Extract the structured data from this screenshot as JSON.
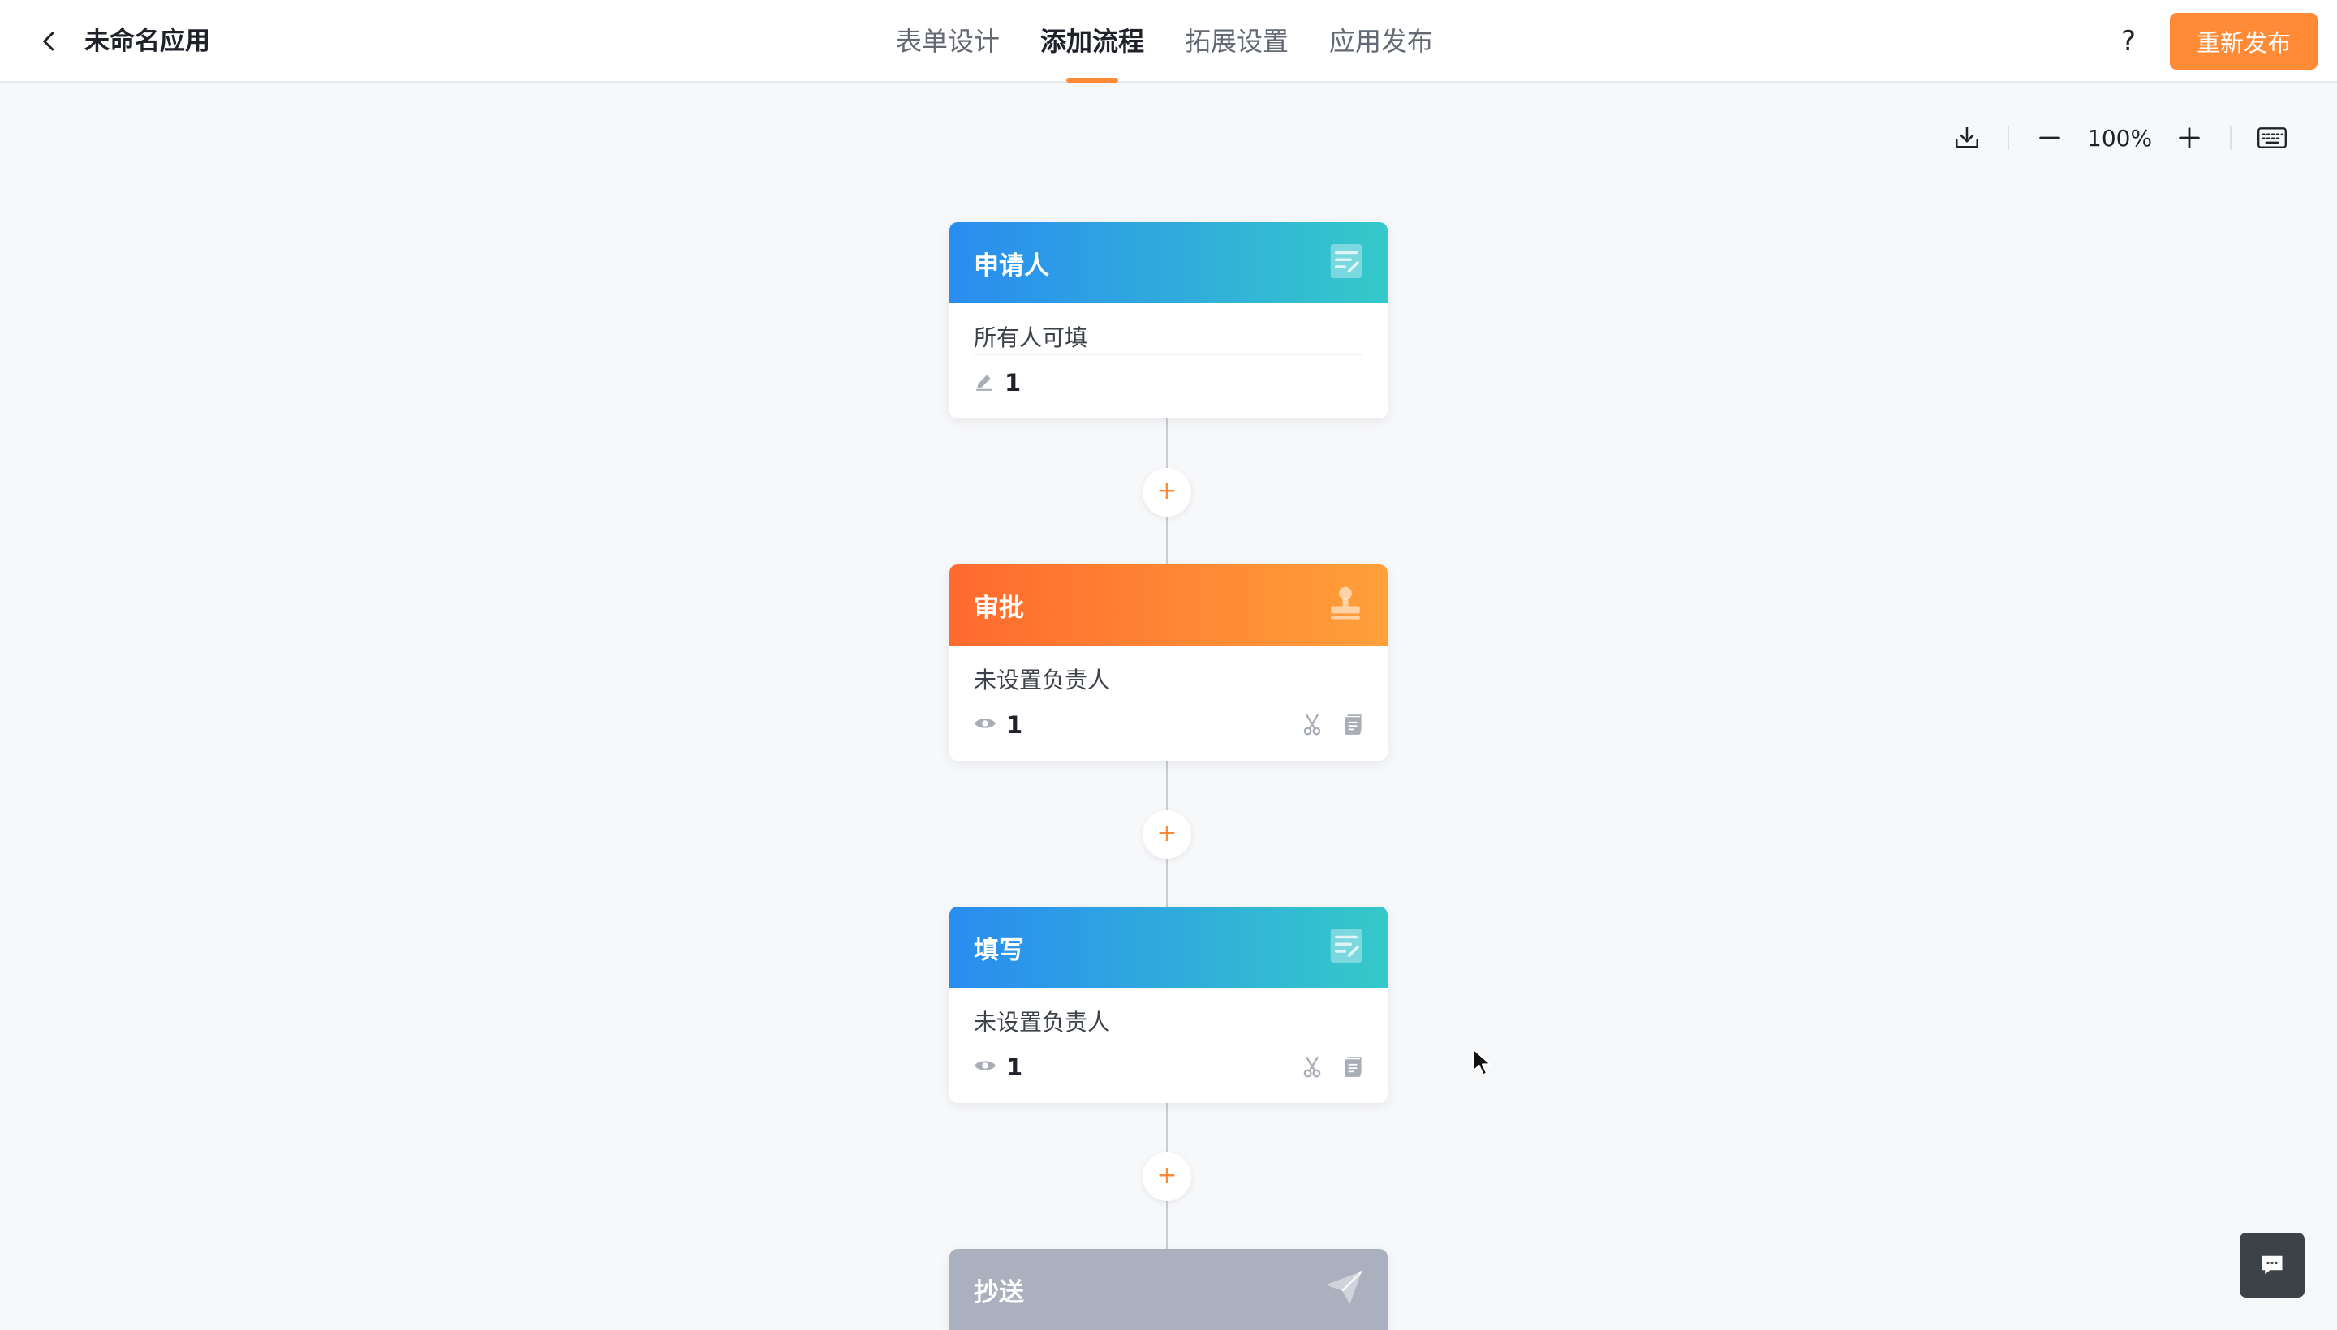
{
  "header": {
    "app_title": "未命名应用",
    "tabs": [
      {
        "label": "表单设计",
        "active": false
      },
      {
        "label": "添加流程",
        "active": true
      },
      {
        "label": "拓展设置",
        "active": false
      },
      {
        "label": "应用发布",
        "active": false
      }
    ],
    "help_label": "?",
    "republish_label": "重新发布"
  },
  "toolbar": {
    "zoom": "100%",
    "icons": [
      "download-icon",
      "zoom-out-icon",
      "zoom-in-icon",
      "keyboard-icon"
    ]
  },
  "flow": {
    "nodes": [
      {
        "title": "申请人",
        "desc": "所有人可填",
        "count": "1",
        "meta_icon": "edit-icon",
        "head_icon": "form-icon",
        "color": "blue"
      },
      {
        "title": "审批",
        "desc": "未设置负责人",
        "count": "1",
        "meta_icon": "eye-icon",
        "head_icon": "stamp-icon",
        "color": "orange"
      },
      {
        "title": "填写",
        "desc": "未设置负责人",
        "count": "1",
        "meta_icon": "eye-icon",
        "head_icon": "form-icon",
        "color": "blue"
      },
      {
        "title": "抄送",
        "head_icon": "send-icon",
        "color": "gray"
      }
    ],
    "add_label": "+"
  },
  "colors": {
    "accent": "#ff8b37",
    "blue_start": "#2a8cf0",
    "blue_end": "#35c9c9",
    "orange_start": "#ff6a2f",
    "orange_end": "#ffa03a",
    "gray_head": "#aab0bd"
  }
}
